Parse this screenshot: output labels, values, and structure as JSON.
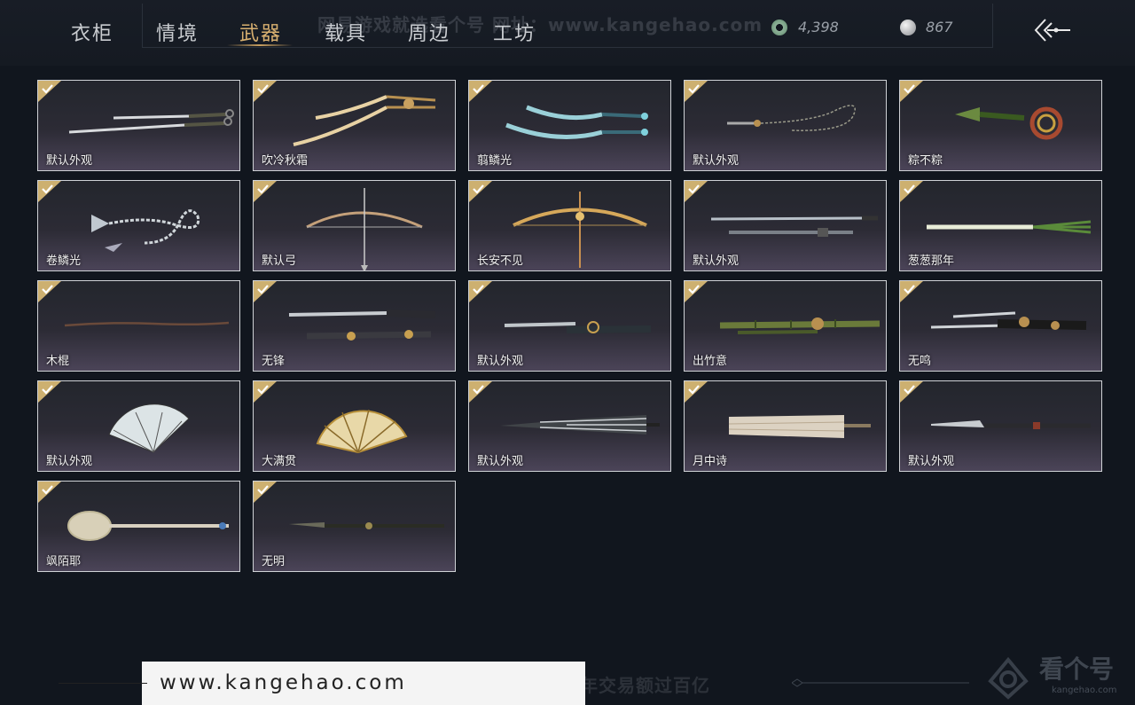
{
  "tabs": [
    {
      "label": "衣柜",
      "active": false
    },
    {
      "label": "情境",
      "active": false
    },
    {
      "label": "武器",
      "active": true
    },
    {
      "label": "载具",
      "active": false
    },
    {
      "label": "周边",
      "active": false
    },
    {
      "label": "工坊",
      "active": false
    }
  ],
  "watermark_top": "网易游戏就选看个号  网址：www.kangehao.com",
  "currency": {
    "jade": "4,398",
    "silver": "867"
  },
  "items": [
    {
      "name": "默认外观",
      "weapon": "twin-swords"
    },
    {
      "name": "吹冷秋霜",
      "weapon": "golden-curved-blades"
    },
    {
      "name": "翦鳞光",
      "weapon": "azure-twin-blades"
    },
    {
      "name": "默认外观",
      "weapon": "rope-dart"
    },
    {
      "name": "粽不粽",
      "weapon": "zongzi-rope-dart"
    },
    {
      "name": "卷鳞光",
      "weapon": "chain-whip-dart"
    },
    {
      "name": "默认弓",
      "weapon": "bow"
    },
    {
      "name": "长安不见",
      "weapon": "golden-bow"
    },
    {
      "name": "默认外观",
      "weapon": "slim-swords"
    },
    {
      "name": "葱葱那年",
      "weapon": "green-onion-staff"
    },
    {
      "name": "木棍",
      "weapon": "wooden-stick"
    },
    {
      "name": "无锋",
      "weapon": "ornate-swords"
    },
    {
      "name": "默认外观",
      "weapon": "sheathed-blade"
    },
    {
      "name": "出竹意",
      "weapon": "bamboo-staff"
    },
    {
      "name": "无鸣",
      "weapon": "black-gold-blades"
    },
    {
      "name": "默认外观",
      "weapon": "white-fan"
    },
    {
      "name": "大满贯",
      "weapon": "golden-fan"
    },
    {
      "name": "默认外观",
      "weapon": "striped-umbrella"
    },
    {
      "name": "月中诗",
      "weapon": "paper-umbrella"
    },
    {
      "name": "默认外观",
      "weapon": "long-glaive"
    },
    {
      "name": "飒陌耶",
      "weapon": "spoon-staff"
    },
    {
      "name": "无明",
      "weapon": "dark-spear"
    }
  ],
  "footer_watermark": "看个号专业网易游戏八年  年交易额过百亿",
  "url_text": "www.kangehao.com",
  "logo": {
    "text": "看个号",
    "sub": "kangehao.com"
  },
  "colors": {
    "active_tab": "#d8b070",
    "check_badge": "#cdb070",
    "background": "#11161e"
  }
}
